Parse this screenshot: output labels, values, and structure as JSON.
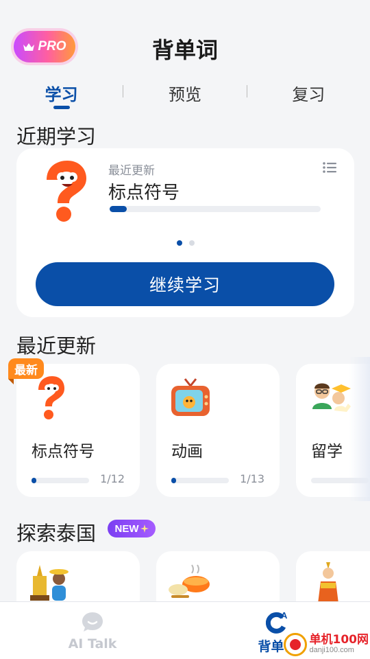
{
  "header": {
    "pro_label": "PRO",
    "title": "背单词"
  },
  "tabs": [
    {
      "label": "学习",
      "active": true
    },
    {
      "label": "预览",
      "active": false
    },
    {
      "label": "复习",
      "active": false
    }
  ],
  "recent_study": {
    "section_title": "近期学习",
    "card": {
      "subtitle": "最近更新",
      "title": "标点符号",
      "progress_fraction": 0.08,
      "page_dots": 2,
      "active_dot": 0,
      "continue_label": "继续学习"
    }
  },
  "recent_updates": {
    "section_title": "最近更新",
    "new_tag": "最新",
    "items": [
      {
        "label": "标点符号",
        "count": "1/12",
        "progress_fraction": 0.08,
        "icon": "question-mascot-icon"
      },
      {
        "label": "动画",
        "count": "1/13",
        "progress_fraction": 0.08,
        "icon": "cartoon-tv-icon"
      },
      {
        "label": "留学",
        "count": "",
        "progress_fraction": 0,
        "icon": "graduates-icon"
      }
    ]
  },
  "explore": {
    "section_title": "探索泰国",
    "new_pill": "NEW",
    "items": [
      {
        "icon": "thai-traveler-icon"
      },
      {
        "icon": "thai-food-icon"
      },
      {
        "icon": "thai-dancer-icon"
      }
    ]
  },
  "bottom_nav": [
    {
      "label": "AI Talk",
      "active": false,
      "icon": "chat-bubble-icon"
    },
    {
      "label": "背单词",
      "active": true,
      "icon": "vocab-icon"
    }
  ],
  "watermark": {
    "text": "单机100网",
    "url": "danji100.com"
  },
  "colors": {
    "primary": "#0a4fa8",
    "accent_orange": "#ff8a1d",
    "pill_purple": "#7b3ff2",
    "background": "#f4f5f7"
  }
}
